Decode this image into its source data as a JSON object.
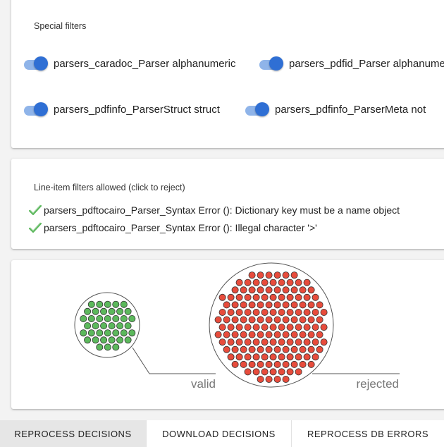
{
  "special_filters": {
    "title": "Special filters",
    "toggles": [
      {
        "label": "parsers_caradoc_Parser alphanumeric",
        "checked": true
      },
      {
        "label": "parsers_pdfid_Parser alphanumeric",
        "checked": true
      },
      {
        "label": "parsers_pdfinfo_ParserStruct struct",
        "checked": true
      },
      {
        "label": "parsers_pdfinfo_ParserMeta not",
        "checked": true
      }
    ]
  },
  "line_item_filters": {
    "title": "Line-item filters allowed (click to reject)",
    "items": [
      {
        "label": "parsers_pdftocairo_Parser_Syntax Error (): Dictionary key must be a name object",
        "icon": "check-icon"
      },
      {
        "label": "parsers_pdftocairo_Parser_Syntax Error (): Illegal character '>'",
        "icon": "check-icon"
      }
    ]
  },
  "visualization": {
    "valid_label": "valid",
    "rejected_label": "rejected",
    "valid_color": "#5cb85c",
    "rejected_color": "#e74c3c"
  },
  "buttons": {
    "reprocess_decisions": "REPROCESS DECISIONS",
    "download_decisions": "DOWNLOAD DECISIONS",
    "reprocess_db_errors": "REPROCESS DB ERRORS"
  },
  "colors": {
    "toggle_thumb": "#2f6fd4",
    "toggle_track": "#8fb4e9",
    "check": "#5cb85c"
  }
}
